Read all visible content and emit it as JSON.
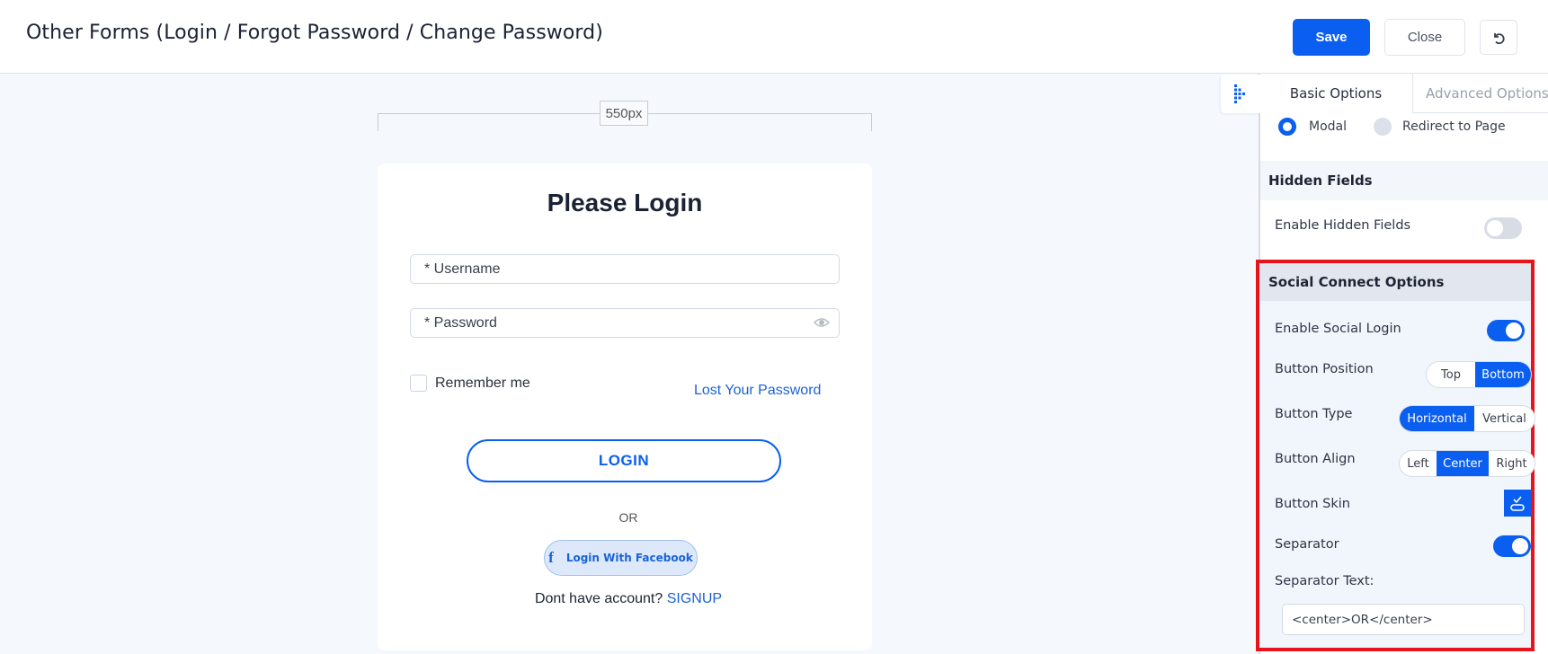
{
  "header": {
    "title": "Other Forms (Login / Forgot Password / Change Password)",
    "save_label": "Save",
    "close_label": "Close",
    "reset_icon": "undo-icon"
  },
  "canvas": {
    "width_label": "550px",
    "form": {
      "title": "Please Login",
      "username_placeholder": "* Username",
      "password_placeholder": "* Password",
      "remember_label": "Remember me",
      "remember_checked": false,
      "lost_password_link": "Lost Your Password",
      "login_button": "LOGIN",
      "separator": "OR",
      "facebook_button": "Login With Facebook",
      "signup_prompt": "Dont have account?",
      "signup_link": "SIGNUP"
    }
  },
  "sidebar": {
    "tabs": [
      {
        "label": "Basic Options",
        "active": true
      },
      {
        "label": "Advanced Options",
        "active": false
      }
    ],
    "display_mode": {
      "options": [
        "Modal",
        "Redirect to Page"
      ],
      "selected": "Modal"
    },
    "hidden_fields": {
      "heading": "Hidden Fields",
      "enable_label": "Enable Hidden Fields",
      "enabled": false
    },
    "social_connect": {
      "heading": "Social Connect Options",
      "enable_label": "Enable Social Login",
      "enabled": true,
      "button_position": {
        "label": "Button Position",
        "options": [
          "Top",
          "Bottom"
        ],
        "selected": "Bottom"
      },
      "button_type": {
        "label": "Button Type",
        "options": [
          "Horizontal",
          "Vertical"
        ],
        "selected": "Horizontal"
      },
      "button_align": {
        "label": "Button Align",
        "options": [
          "Left",
          "Center",
          "Right"
        ],
        "selected": "Center"
      },
      "button_skin": {
        "label": "Button Skin"
      },
      "separator": {
        "label": "Separator",
        "enabled": true
      },
      "separator_text": {
        "label": "Separator Text:",
        "value": "<center>OR</center>"
      }
    }
  },
  "colors": {
    "accent": "#0a5ff0",
    "highlight_border": "#e8141c",
    "link": "#1a63d6"
  }
}
